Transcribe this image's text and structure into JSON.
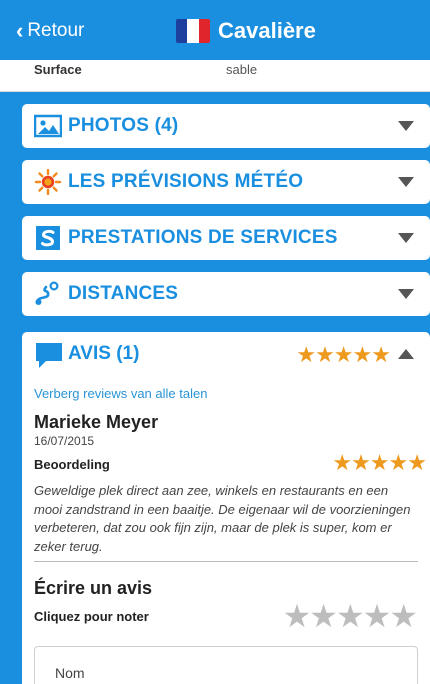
{
  "header": {
    "back_label": "Retour",
    "title": "Cavalière",
    "flag_colors": [
      "#1d3f9e",
      "#ffffff",
      "#e0262c"
    ]
  },
  "surface": {
    "label": "Surface",
    "value": "sable"
  },
  "sections": [
    {
      "label": "PHOTOS (4)",
      "icon": "image-icon"
    },
    {
      "label": "LES PRÉVISIONS MÉTÉO",
      "icon": "sun-icon"
    },
    {
      "label": "PRESTATIONS DE SERVICES",
      "icon": "services-s-icon"
    },
    {
      "label": "DISTANCES",
      "icon": "distance-pin-icon"
    }
  ],
  "reviews": {
    "label": "AVIS (1)",
    "icon": "speech-bubble-icon",
    "overall_rating": 5,
    "max_rating": 5,
    "hide_other_languages": "Verberg reviews van alle talen",
    "items": [
      {
        "author": "Marieke Meyer",
        "date": "16/07/2015",
        "rating_label": "Beoordeling",
        "rating": 5,
        "text": "Geweldige plek direct aan zee, winkels en restaurants en een mooi zandstrand in een baaitje. De eigenaar wil de voorzieningen verbeteren, dat zou ook fijn zijn, maar de plek is super, kom er zeker terug."
      }
    ],
    "write": {
      "title": "Écrire un avis",
      "click_to_rate": "Cliquez pour noter",
      "name_placeholder": "Nom",
      "name_value": ""
    }
  },
  "colors": {
    "brand_blue": "#1a8fe0",
    "star_gold": "#ee9a1e",
    "star_empty": "#bdbdbd"
  }
}
